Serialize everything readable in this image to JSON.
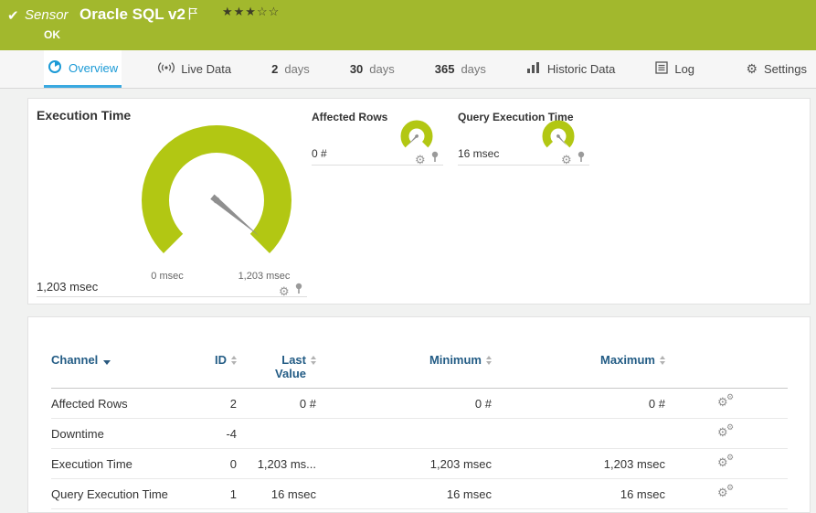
{
  "header": {
    "kind": "Sensor",
    "title": "Oracle SQL v2",
    "status": "OK",
    "stars": "★★★☆☆"
  },
  "tabs": {
    "overview": "Overview",
    "live_data": "Live Data",
    "days2_num": "2",
    "days2_unit": "days",
    "days30_num": "30",
    "days30_unit": "days",
    "days365_num": "365",
    "days365_unit": "days",
    "historic_data": "Historic Data",
    "log": "Log",
    "settings": "Settings"
  },
  "gauges": {
    "execution_time": {
      "title": "Execution Time",
      "value": "1,203 msec",
      "min_label": "0 msec",
      "max_label": "1,203 msec"
    },
    "affected_rows": {
      "title": "Affected Rows",
      "value": "0 #"
    },
    "query_execution_time": {
      "title": "Query Execution Time",
      "value": "16 msec"
    }
  },
  "chart_data": [
    {
      "type": "gauge",
      "title": "Execution Time",
      "value": 1203,
      "min": 0,
      "max": 1203,
      "unit": "msec"
    },
    {
      "type": "gauge",
      "title": "Affected Rows",
      "value": 0,
      "unit": "#"
    },
    {
      "type": "gauge",
      "title": "Query Execution Time",
      "value": 16,
      "unit": "msec"
    }
  ],
  "table": {
    "headers": {
      "channel": "Channel",
      "id": "ID",
      "last_value": "Last Value",
      "minimum": "Minimum",
      "maximum": "Maximum"
    },
    "rows": [
      {
        "channel": "Affected Rows",
        "id": "2",
        "last": "0 #",
        "min": "0 #",
        "max": "0 #"
      },
      {
        "channel": "Downtime",
        "id": "-4",
        "last": "",
        "min": "",
        "max": ""
      },
      {
        "channel": "Execution Time",
        "id": "0",
        "last": "1,203 ms...",
        "min": "1,203 msec",
        "max": "1,203 msec"
      },
      {
        "channel": "Query Execution Time",
        "id": "1",
        "last": "16 msec",
        "min": "16 msec",
        "max": "16 msec"
      }
    ]
  },
  "colors": {
    "header_green": "#a2b82d",
    "gauge_green": "#b2c713",
    "accent_blue": "#1b9ad6",
    "table_header_blue": "#235c85"
  }
}
